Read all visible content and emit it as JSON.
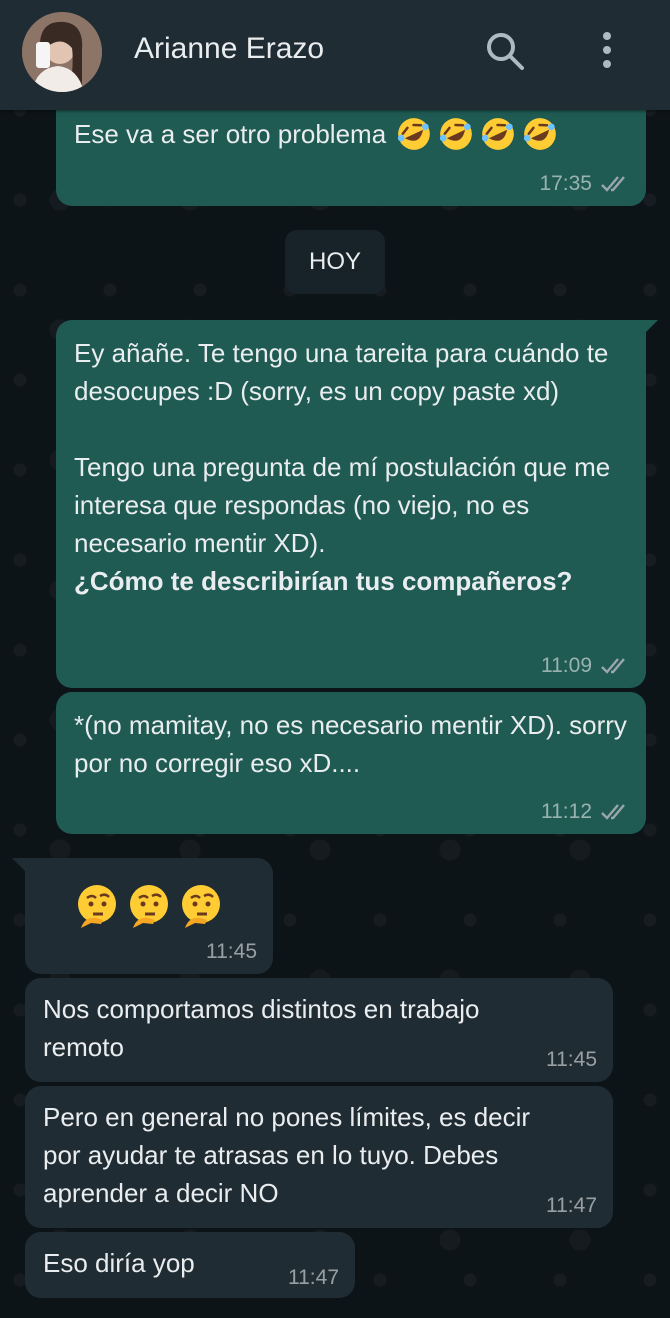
{
  "header": {
    "contact_name": "Arianne Erazo",
    "search_icon": "search-icon",
    "menu_icon": "more-vertical-icon"
  },
  "day_divider": "HOY",
  "messages": [
    {
      "direction": "out",
      "text": "Ese va a ser otro problema",
      "emoji": "rolling-on-floor-laughing x4",
      "time": "17:35",
      "status": "read"
    },
    {
      "direction": "out",
      "text": "Ey añañe. Te tengo una tareita para cuándo te desocupes :D (sorry, es un copy paste xd)\n\nTengo una pregunta de mí postulación que me interesa que respondas (no viejo, no es necesario mentir XD).",
      "bold_text": " ¿Cómo te describirían tus compañeros?",
      "time": "11:09",
      "status": "read"
    },
    {
      "direction": "out",
      "text": "*(no mamitay, no es necesario mentir XD). sorry por no corregir eso xD....",
      "time": "11:12",
      "status": "read"
    },
    {
      "direction": "in",
      "emoji": "thinking-face x3",
      "time": "11:45"
    },
    {
      "direction": "in",
      "text": "Nos comportamos distintos en trabajo remoto",
      "time": "11:45"
    },
    {
      "direction": "in",
      "text": "Pero en general no pones límites, es decir por ayudar te atrasas en lo tuyo. Debes aprender a decir NO",
      "time": "11:47"
    },
    {
      "direction": "in",
      "text": "Eso diría yop",
      "time": "11:47"
    }
  ],
  "colors": {
    "header_bg": "#202c33",
    "outgoing_bubble": "#1f5a53",
    "incoming_bubble": "#202c33",
    "read_ticks": "#9aa6ac"
  }
}
